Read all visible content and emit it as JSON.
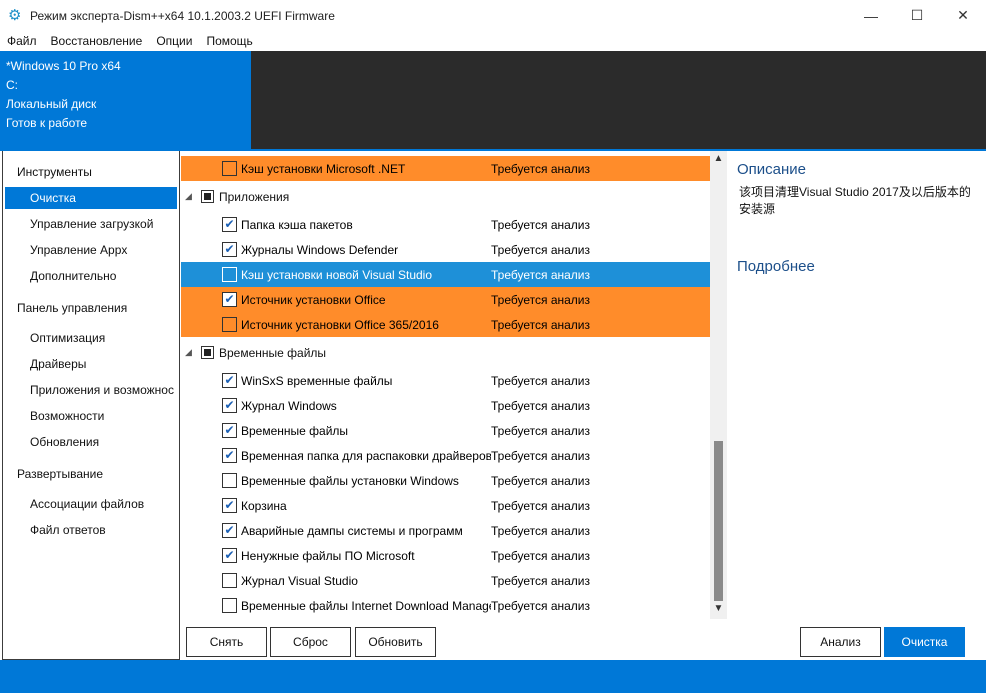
{
  "window": {
    "title": "Режим эксперта-Dism++x64 10.1.2003.2 UEFI Firmware",
    "minimize": "—",
    "maximize": "☐",
    "close": "✕"
  },
  "menu": [
    "Файл",
    "Восстановление",
    "Опции",
    "Помощь"
  ],
  "info": {
    "os": "*Windows 10 Pro x64",
    "drive": "C:",
    "disk": "Локальный диск",
    "status": "Готов к работе"
  },
  "sidebar": {
    "sections": [
      {
        "title": "Инструменты",
        "items": [
          "Очистка",
          "Управление загрузкой",
          "Управление Appx",
          "Дополнительно"
        ]
      },
      {
        "title": "Панель управления",
        "items": [
          "Оптимизация",
          "Драйверы",
          "Приложения и возможнос",
          "Возможности",
          "Обновления"
        ]
      },
      {
        "title": "Развертывание",
        "items": [
          "Ассоциации файлов",
          "Файл ответов"
        ]
      }
    ],
    "active": "Очистка"
  },
  "list": {
    "status_text": "Требуется анализ",
    "top_row": {
      "name": "Кэш установки Microsoft .NET",
      "checked": false,
      "style": "orange"
    },
    "groups": [
      {
        "name": "Приложения",
        "rows": [
          {
            "name": "Папка кэша пакетов",
            "checked": true,
            "style": ""
          },
          {
            "name": "Журналы Windows Defender",
            "checked": true,
            "style": ""
          },
          {
            "name": "Кэш установки новой Visual Studio",
            "checked": false,
            "style": "blue"
          },
          {
            "name": "Источник установки Office",
            "checked": true,
            "style": "orange"
          },
          {
            "name": "Источник установки Office 365/2016",
            "checked": false,
            "style": "orange"
          }
        ]
      },
      {
        "name": "Временные файлы",
        "rows": [
          {
            "name": "WinSxS временные файлы",
            "checked": true,
            "style": ""
          },
          {
            "name": "Журнал Windows",
            "checked": true,
            "style": ""
          },
          {
            "name": "Временные файлы",
            "checked": true,
            "style": ""
          },
          {
            "name": "Временная папка для распаковки драйверов",
            "checked": true,
            "style": ""
          },
          {
            "name": "Временные файлы установки Windows",
            "checked": false,
            "style": ""
          },
          {
            "name": "Корзина",
            "checked": true,
            "style": ""
          },
          {
            "name": "Аварийные дампы системы и программ",
            "checked": true,
            "style": ""
          },
          {
            "name": "Ненужные файлы ПО Microsoft",
            "checked": true,
            "style": ""
          },
          {
            "name": "Журнал Visual Studio",
            "checked": false,
            "style": ""
          },
          {
            "name": "Временные файлы Internet Download Manage",
            "checked": false,
            "style": ""
          }
        ]
      }
    ]
  },
  "description": {
    "title": "Описание",
    "text": "该项目清理Visual Studio 2017及以后版本的安装源",
    "more": "Подробнее"
  },
  "buttons": {
    "remove": "Снять",
    "reset": "Сброс",
    "refresh": "Обновить",
    "analyze": "Анализ",
    "clean": "Очистка"
  },
  "colors": {
    "accent": "#0078d7",
    "highlight": "#ff8c2a",
    "dark": "#2b2b2b"
  }
}
